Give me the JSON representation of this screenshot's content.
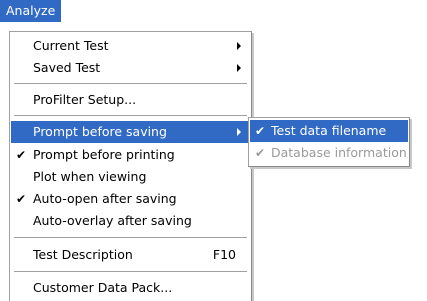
{
  "menubar": {
    "active_menu": "Analyze"
  },
  "menu": {
    "items": [
      {
        "label": "Current Test",
        "has_submenu": true
      },
      {
        "label": "Saved Test",
        "has_submenu": true
      },
      {
        "label": "ProFilter Setup..."
      },
      {
        "label": "Prompt before saving",
        "has_submenu": true,
        "highlighted": true
      },
      {
        "label": "Prompt before printing",
        "checked": true,
        "check_glyph": "✔"
      },
      {
        "label": "Plot when viewing"
      },
      {
        "label": "Auto-open after saving",
        "checked": true,
        "check_glyph": "✔"
      },
      {
        "label": "Auto-overlay after saving"
      },
      {
        "label": "Test Description",
        "shortcut": "F10"
      },
      {
        "label": "Customer Data Pack..."
      }
    ]
  },
  "submenu": {
    "items": [
      {
        "label": "Test data filename",
        "checked": true,
        "check_glyph": "✔",
        "highlighted": true
      },
      {
        "label": "Database information",
        "checked": true,
        "check_glyph": "✔",
        "disabled": true
      }
    ]
  },
  "colors": {
    "highlight": "#316ac5",
    "disabled_text": "#9a9a9a"
  }
}
